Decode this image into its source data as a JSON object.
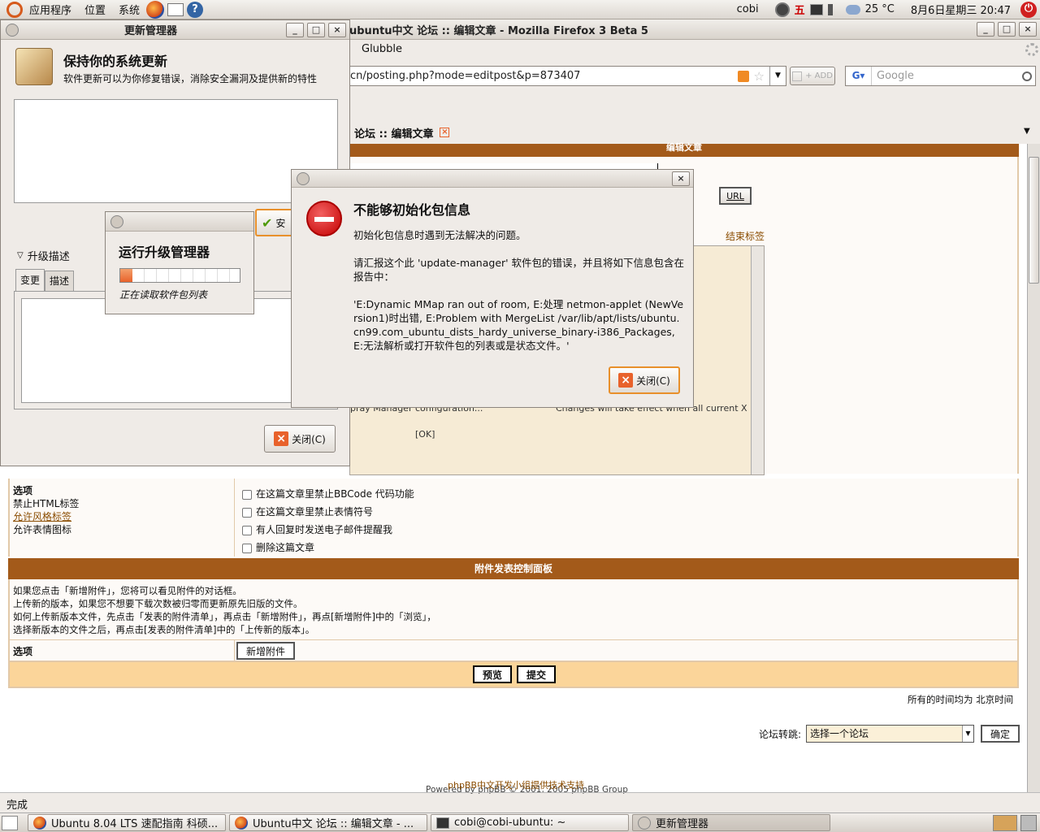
{
  "panel": {
    "menus": [
      "应用程序",
      "位置",
      "系统"
    ],
    "user": "cobi",
    "cpu_label": "五",
    "weather": "25 °C",
    "datetime": "8月6日星期三  20:47"
  },
  "firefox": {
    "title": "ubuntu中文 论坛 :: 编辑文章  - Mozilla Firefox 3 Beta 5",
    "menu_glubble": "Glubble",
    "url": "cn/posting.php?mode=editpost&p=873407",
    "add_label": "+ ADD",
    "search_placeholder": "Google",
    "tab_label": "论坛 :: 编辑文章",
    "edit_header": "编辑文章",
    "url_button": "URL",
    "close_tags": "结束标签",
    "bg_text_left": "pray Manager configuration...",
    "bg_text_right": "Changes will take effect when all current X",
    "bg_ok": "[OK]",
    "options_title": "选项",
    "options_left": [
      "禁止HTML标签",
      "允许风格标签",
      "允许表情图标"
    ],
    "options_checks": [
      "在这篇文章里禁止BBCode 代码功能",
      "在这篇文章里禁止表情符号",
      "有人回复时发送电子邮件提醒我",
      "删除这篇文章"
    ],
    "attach_header": "附件发表控制面板",
    "attach_lines": [
      "如果您点击「新增附件」，您将可以看见附件的对话框。",
      "上传新的版本，如果您不想要下载次数被归零而更新原先旧版的文件。",
      "如何上传新版本文件，先点击「发表的附件清单」，再点击「新增附件」，再点[新增附件]中的「浏览」，",
      "选择新版本的文件之后，再点击[发表的附件清单]中的「上传新的版本」。"
    ],
    "attach_options": "选项",
    "add_attach_btn": "新增附件",
    "preview_btn": "预览",
    "submit_btn": "提交",
    "timezone": "所有的时间均为 北京时间",
    "jump_label": "论坛转跳:",
    "jump_select": "选择一个论坛",
    "jump_btn": "确定",
    "powered": "Powered by phpBB © 2001, 2005 phpBB Group",
    "support": "phpBB中文开发小组提供技术支持",
    "status": "完成"
  },
  "update_manager": {
    "title": "更新管理器",
    "heading": "保持你的系统更新",
    "subtitle": "软件更新可以为你修复错误，消除安全漏洞及提供新的特性",
    "install_partial": "安",
    "expander": "升级描述",
    "tab_changes": "变更",
    "tab_desc": "描述",
    "close_btn": "关闭(C)"
  },
  "progress": {
    "title": "运行升级管理器",
    "status": "正在读取软件包列表",
    "fraction": 0.1
  },
  "error": {
    "title": "不能够初始化包信息",
    "line1": "初始化包信息时遇到无法解决的问题。",
    "line2": "请汇报这个此 'update-manager' 软件包的错误，并且将如下信息包含在报告中：",
    "details": "'E:Dynamic MMap ran out of room, E:处理 netmon-applet (NewVersion1)时出错, E:Problem with MergeList /var/lib/apt/lists/ubuntu.cn99.com_ubuntu_dists_hardy_universe_binary-i386_Packages, E:无法解析或打开软件包的列表或是状态文件。'",
    "close_btn": "关闭(C)"
  },
  "taskbar": [
    "Ubuntu 8.04 LTS 速配指南 科硕...",
    "Ubuntu中文 论坛 :: 编辑文章 - ...",
    "cobi@cobi-ubuntu: ~",
    "更新管理器"
  ]
}
